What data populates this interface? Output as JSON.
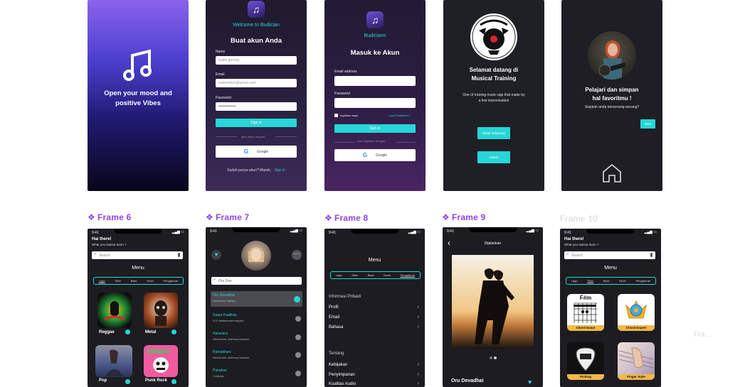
{
  "colors": {
    "accent": "#27d6d6",
    "purple_label": "#8b46e8",
    "phone_bg": "#1b1b22"
  },
  "s1": {
    "title_l1": "Open your mood and",
    "title_l2": "positive Vibes",
    "icon": "music-note-icon"
  },
  "s2": {
    "welcome": "Welcome to Budician",
    "heading": "Buat akun Anda",
    "name_label": "Name",
    "name_value": "budin goreng",
    "email_label": "Email",
    "email_value": "budinmbuh@gmail.com",
    "password_label": "Password",
    "password_value": "••••••••••••••",
    "signin": "Sign in",
    "divider": "atau lanjut dengan",
    "google": "Google",
    "footer_text": "Sudah punya akun? Masuk,",
    "footer_link": "Sign in"
  },
  "s3": {
    "brand": "Budiciann",
    "heading": "Masuk ke Akun",
    "email_label": "Email address",
    "password_label": "Password",
    "remember": "Ingatkan saya",
    "forgot": "Lupa Password ?",
    "signin": "Sign in",
    "divider": "atau lanjutkan dengan",
    "google": "Google"
  },
  "s4": {
    "title_l1": "Selamat datang di",
    "title_l2": "Musical Training",
    "desc_l1": "One of training music app that made by",
    "desc_l2": "a few improvisation",
    "start": "Mulai Sekarang",
    "exit": "Keluar"
  },
  "s5": {
    "title_l1": "Pelajari dan simpan",
    "title_l2": "hal favoritmu !",
    "subtitle": "Siapkah anda bersenang-senang?",
    "next": "Next",
    "home_icon": "home-icon"
  },
  "labels": {
    "f6": "Frame 6",
    "f7": "Frame 7",
    "f8": "Frame 8",
    "f9": "Frame 9",
    "f10": "Frame 10",
    "f11": "Fra..."
  },
  "f6": {
    "time": "9:41",
    "greeting": "Hai there!",
    "question": "What you wanna learn ?",
    "search": "Search",
    "menu": "Menu",
    "tabs": [
      "Lagu",
      "Gitar",
      "Bass",
      "Drum",
      "Pengaturan"
    ],
    "cards": [
      "Reggae",
      "Metal",
      "Pop",
      "Punk Rock"
    ]
  },
  "f7": {
    "time": "9:41",
    "search": "Oru Dev",
    "songs": [
      {
        "title": "Oru Devadhai",
        "artist": "Rasamma Sufistic"
      },
      {
        "title": "Saara Kaattrae",
        "artist": "S.P. Balasubrahmanyam"
      },
      {
        "title": "Naranara",
        "artist": "Neeah Azir, Anthony Daasan"
      },
      {
        "title": "Ramadhani",
        "artist": "Neeah Azir, Anthony Daasan"
      },
      {
        "title": "Paradise",
        "artist": "Coldplay"
      }
    ]
  },
  "f8": {
    "time": "9:41",
    "menu": "Menu",
    "tabs": [
      "Lagu",
      "Gitar",
      "Bass",
      "Drum",
      "Pengaturan"
    ],
    "section1": "Informasi Pribadi",
    "items1": [
      "Profil",
      "Email",
      "Bahasa"
    ],
    "section2": "Tentang",
    "items2": [
      "Kebijakan",
      "Penyimpanan",
      "Kualitas Audio"
    ]
  },
  "f9": {
    "time": "9:41",
    "now_playing": "Dijalankan",
    "song": "Oru Devadhai"
  },
  "f10": {
    "time": "9:41",
    "greeting": "Hai there!",
    "question": "What you wanna learn ?",
    "search": "Search",
    "menu": "Menu",
    "tabs": [
      "Lagu",
      "Gitar",
      "Bass",
      "Drum",
      "Pengaturan"
    ],
    "chord_symbol": "F#m",
    "cards": [
      "Chord Dasar",
      "Chord Expert",
      "Picking",
      "Finger Style"
    ]
  }
}
